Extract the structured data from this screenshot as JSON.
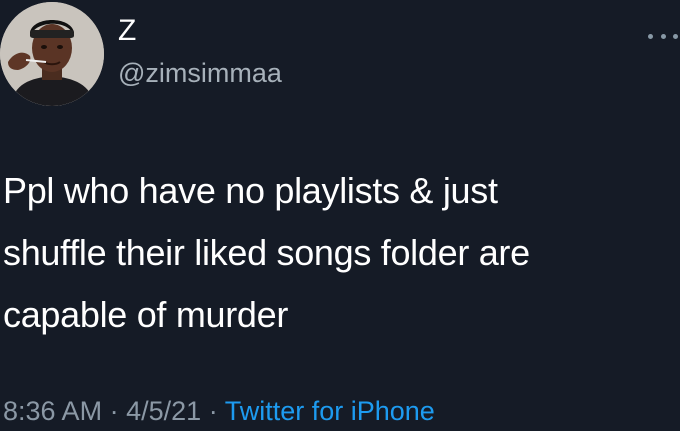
{
  "tweet": {
    "author": {
      "display_name": "Z",
      "handle": "@zimsimmaa"
    },
    "text_lines": [
      "Ppl who have no playlists & just",
      "shuffle their liked songs folder are",
      "capable of murder"
    ],
    "meta": {
      "time": "8:36 AM",
      "separator": "·",
      "date": "4/5/21",
      "source": "Twitter for iPhone"
    }
  },
  "icons": {
    "more": "more-horizontal-icon"
  },
  "colors": {
    "background": "#151b26",
    "text": "#ffffff",
    "secondary": "#8b98a5",
    "link": "#1d9bf0"
  }
}
